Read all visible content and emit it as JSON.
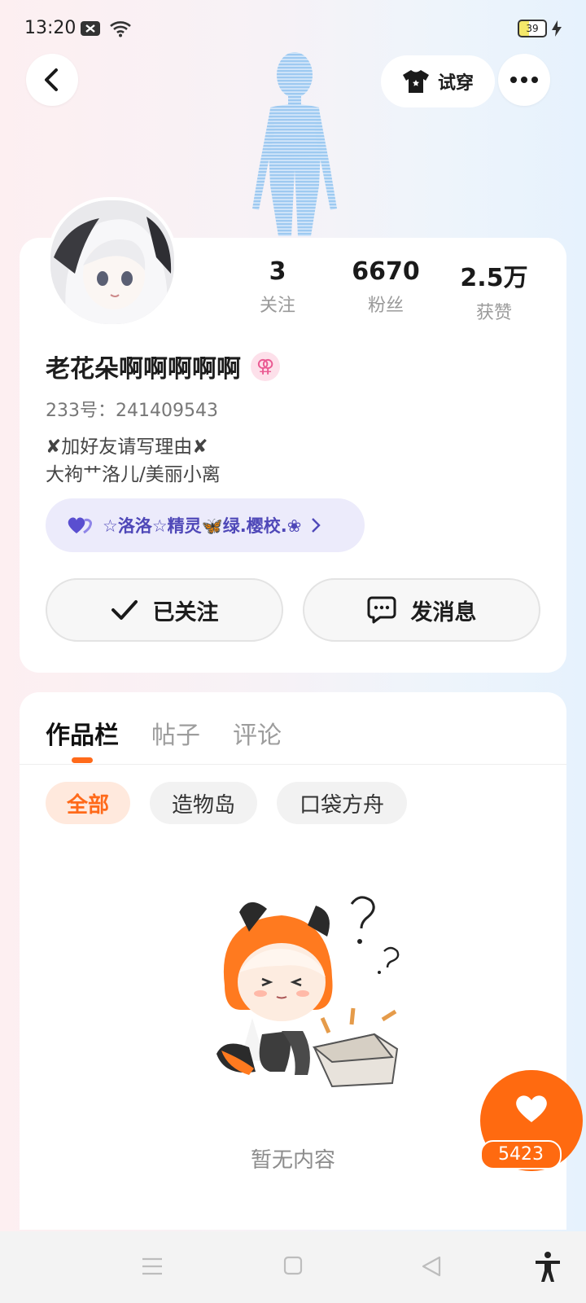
{
  "status_bar": {
    "time": "13:20",
    "battery": "39"
  },
  "header": {
    "try_on_label": "试穿"
  },
  "profile": {
    "stats": [
      {
        "value": "3",
        "label": "关注"
      },
      {
        "value": "6670",
        "label": "粉丝"
      },
      {
        "value": "2.5万",
        "label": "获赞"
      }
    ],
    "username": "老花朵啊啊啊啊啊",
    "gender_symbol": "⚢",
    "uid": "233号：241409543",
    "bio_line1": "✘加好友请写理由✘",
    "bio_line2": "大袧艹洛儿/美丽小离",
    "group_label": "☆洛洛☆精灵🦋绿.樱校.❀",
    "follow_label": "已关注",
    "message_label": "发消息"
  },
  "tabs": [
    {
      "label": "作品栏",
      "active": true
    },
    {
      "label": "帖子",
      "active": false
    },
    {
      "label": "评论",
      "active": false
    }
  ],
  "filters": [
    {
      "label": "全部",
      "active": true
    },
    {
      "label": "造物岛",
      "active": false
    },
    {
      "label": "口袋方舟",
      "active": false
    }
  ],
  "empty_state": {
    "text": "暂无内容"
  },
  "like_fab": {
    "count": "5423"
  },
  "colors": {
    "accent": "#ff6a10",
    "group_text": "#4f48b8"
  }
}
